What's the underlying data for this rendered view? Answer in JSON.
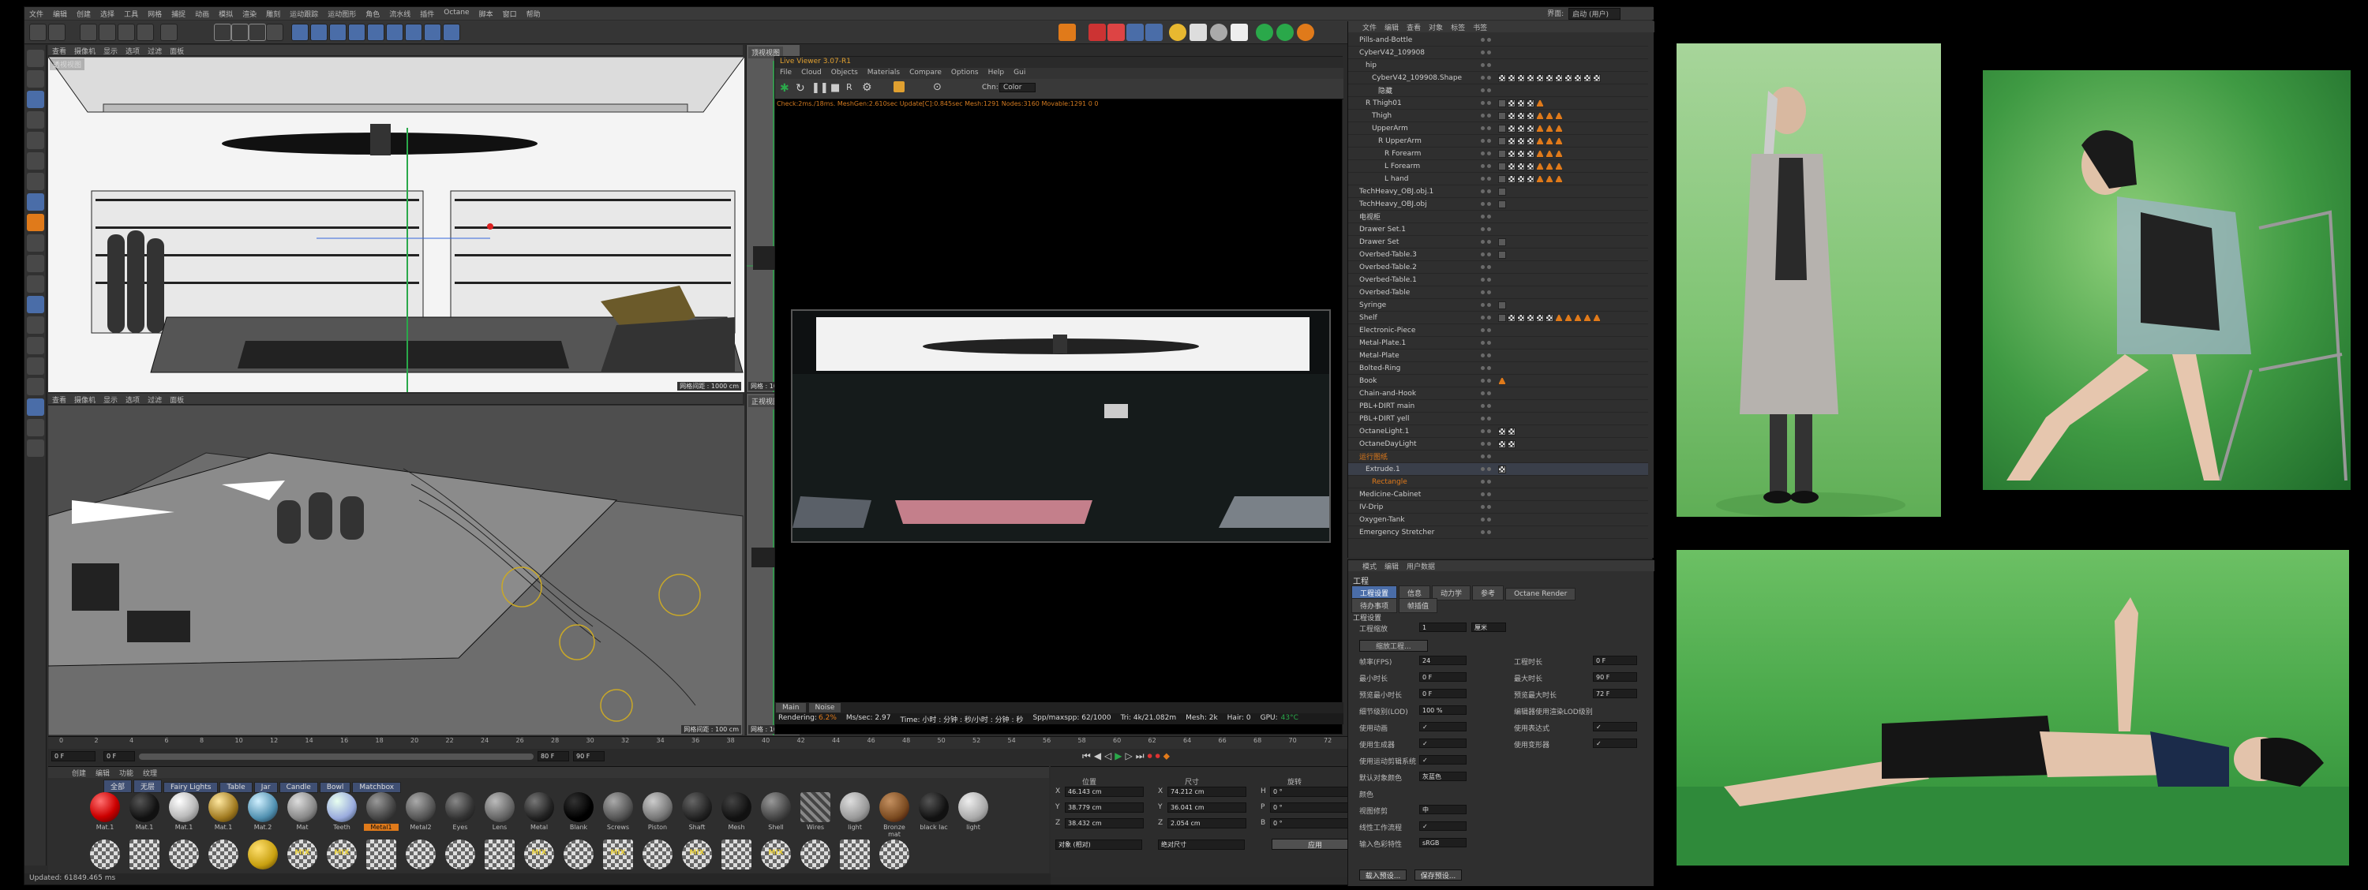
{
  "app": {
    "menu": [
      "文件",
      "编辑",
      "创建",
      "选择",
      "工具",
      "网格",
      "捕捉",
      "动画",
      "模拟",
      "渲染",
      "雕刻",
      "运动跟踪",
      "运动图形",
      "角色",
      "流水线",
      "插件",
      "Octane",
      "脚本",
      "窗口",
      "帮助"
    ],
    "layout_label": "界面:",
    "layout_value": "启动 (用户)"
  },
  "viewport_top": {
    "menu": [
      "查看",
      "摄像机",
      "显示",
      "选项",
      "过滤",
      "面板"
    ],
    "name": "透视视图",
    "grid": "网格间距 : 1000 cm"
  },
  "viewport_bottom": {
    "menu": [
      "查看",
      "摄像机",
      "显示",
      "选项",
      "过滤",
      "面板"
    ],
    "grid": "网格间距 : 100 cm"
  },
  "side_views": {
    "top_name": "顶视视图",
    "bottom_name": "正视视图",
    "grid_top": "网格 : 100 cm",
    "grid_bottom": "网格 : 100 cm"
  },
  "live_viewer": {
    "title": "Live Viewer 3.07-R1",
    "menu": [
      "File",
      "Cloud",
      "Objects",
      "Materials",
      "Compare",
      "Options",
      "Help",
      "Gui"
    ],
    "channel_label": "Chn:",
    "channel_value": "Color",
    "stats_line": "Check:2ms./18ms. MeshGen:2.610sec Update[C]:0.845sec Mesh:1291 Nodes:3160 Movable:1291  0 0",
    "tab_main": "Main",
    "tab_noise": "Noise",
    "status": {
      "rendering_label": "Rendering:",
      "rendering_value": "6.2%",
      "mssec": "Ms/sec: 2.97",
      "time": "Time: 小时 : 分钟 : 秒/小时 : 分钟 : 秒",
      "spp": "Spp/maxspp: 62/1000",
      "tri": "Tri: 4k/21.082m",
      "mesh": "Mesh: 2k",
      "hair": "Hair: 0",
      "gpu": "GPU:",
      "temp": "43°C"
    }
  },
  "timeline": {
    "ticks": [
      "0",
      "2",
      "4",
      "6",
      "8",
      "10",
      "12",
      "14",
      "16",
      "18",
      "20",
      "22",
      "24",
      "26",
      "28",
      "30",
      "32",
      "34",
      "36",
      "38",
      "40",
      "42",
      "44",
      "46",
      "48",
      "50",
      "52",
      "54",
      "56",
      "58",
      "60",
      "62",
      "64",
      "66",
      "68",
      "70",
      "72",
      "74"
    ],
    "current_frame": "0 F",
    "start": "0 F",
    "end": "80 F",
    "end_right": "90 F",
    "frame_badge": "0 F"
  },
  "material_panel": {
    "menu": [
      "创建",
      "编辑",
      "功能",
      "纹理"
    ],
    "tabs": [
      "全部",
      "无层",
      "Fairy Lights",
      "Table",
      "Jar",
      "Candle",
      "Bowl",
      "Matchbox"
    ],
    "row1": [
      "Mat.1",
      "Mat.1",
      "Mat.1",
      "Mat.1",
      "Mat.2",
      "Mat",
      "Teeth",
      "Metal1",
      "Metal2",
      "Eyes",
      "Lens",
      "Metal",
      "Blank",
      "Screws",
      "Piston",
      "Shaft",
      "Mesh",
      "Shell",
      "Wires",
      "light",
      "Bronze mat",
      "black lac",
      "light"
    ],
    "row2": [
      "",
      "",
      "",
      "",
      "",
      "MIX",
      "MIX",
      "",
      "",
      "",
      "",
      "MIX",
      "",
      "MIX",
      "",
      "MIX",
      "",
      "MIX",
      "",
      "",
      ""
    ]
  },
  "coords": {
    "headers": [
      "位置",
      "尺寸",
      "旋转"
    ],
    "rows": [
      {
        "axis": "X",
        "pos": "46.143 cm",
        "axis2": "X",
        "size": "74.212 cm",
        "axis3": "H",
        "rot": "0 °"
      },
      {
        "axis": "Y",
        "pos": "38.779 cm",
        "axis2": "Y",
        "size": "36.041 cm",
        "axis3": "P",
        "rot": "0 °"
      },
      {
        "axis": "Z",
        "pos": "38.432 cm",
        "axis2": "Z",
        "size": "2.054 cm",
        "axis3": "B",
        "rot": "0 °"
      }
    ],
    "mode1": "对象 (相对)",
    "mode2": "绝对尺寸",
    "apply": "应用"
  },
  "object_manager": {
    "menu": [
      "文件",
      "编辑",
      "查看",
      "对象",
      "标签",
      "书签"
    ],
    "objects": [
      "Pills-and-Bottle",
      "CyberV42_109908",
      "hip",
      "CyberV42_109908.Shape",
      "隐藏",
      "R Thigh01",
      "Thigh",
      "UpperArm",
      "R UpperArm",
      "R Forearm",
      "L Forearm",
      "L hand",
      "TechHeavy_OBJ.obj.1",
      "TechHeavy_OBJ.obj",
      "电视柜",
      "Drawer Set.1",
      "Drawer Set",
      "Overbed-Table.3",
      "Overbed-Table.2",
      "Overbed-Table.1",
      "Overbed-Table",
      "Syringe",
      "Shelf",
      "Electronic-Piece",
      "Metal-Plate.1",
      "Metal-Plate",
      "Bolted-Ring",
      "Book",
      "Chain-and-Hook",
      "PBL+DIRT main",
      "PBL+DIRT yell",
      "OctaneLight.1",
      "OctaneDayLight",
      "运行图纸",
      "Extrude.1",
      "Rectangle",
      "Medicine-Cabinet",
      "IV-Drip",
      "Oxygen-Tank",
      "Emergency Stretcher"
    ]
  },
  "attributes": {
    "menu": [
      "模式",
      "编辑",
      "用户数据"
    ],
    "title": "工程",
    "tabs_row1": [
      "工程设置",
      "信息",
      "动力学",
      "参考",
      "Octane Render"
    ],
    "tabs_row2": [
      "待办事项",
      "帧插值"
    ],
    "section": "工程设置",
    "fields": [
      {
        "label": "工程缩放",
        "value": "1",
        "unit": "厘米"
      },
      {
        "label": "缩放工程...",
        "value": "",
        "unit": ""
      },
      {
        "label": "帧率(FPS)",
        "value": "24",
        "label2": "工程时长",
        "value2": "0 F"
      },
      {
        "label": "最小时长",
        "value": "0 F",
        "label2": "最大时长",
        "value2": "90 F"
      },
      {
        "label": "预览最小时长",
        "value": "0 F",
        "label2": "预览最大时长",
        "value2": "72 F"
      },
      {
        "label": "细节级别(LOD)",
        "value": "100 %",
        "label2": "编辑器使用渲染LOD级别",
        "value2": ""
      },
      {
        "label": "使用动画",
        "value": "✓",
        "label2": "使用表达式",
        "value2": "✓"
      },
      {
        "label": "使用生成器",
        "value": "✓",
        "label2": "使用变形器",
        "value2": "✓"
      },
      {
        "label": "使用运动剪辑系统",
        "value": "✓",
        "label2": "",
        "value2": ""
      },
      {
        "label": "默认对象颜色",
        "value": "灰蓝色",
        "label2": "",
        "value2": ""
      },
      {
        "label": "颜色",
        "value": "",
        "label2": "",
        "value2": ""
      },
      {
        "label": "视图修剪",
        "value": "中",
        "label2": "",
        "value2": ""
      },
      {
        "label": "线性工作流程",
        "value": "✓",
        "label2": "",
        "value2": ""
      },
      {
        "label": "输入色彩特性",
        "value": "sRGB",
        "label2": "",
        "value2": ""
      }
    ],
    "btn_load": "载入预设...",
    "btn_save": "保存预设..."
  },
  "statusbar": "Updated: 61849.465 ms",
  "photos": [
    "photo-standing-coat",
    "photo-sitting-chair",
    "photo-lying-floor"
  ],
  "colors": {
    "accent": "#4a6da8",
    "orange": "#e07a1a",
    "green": "#2aa84a"
  }
}
